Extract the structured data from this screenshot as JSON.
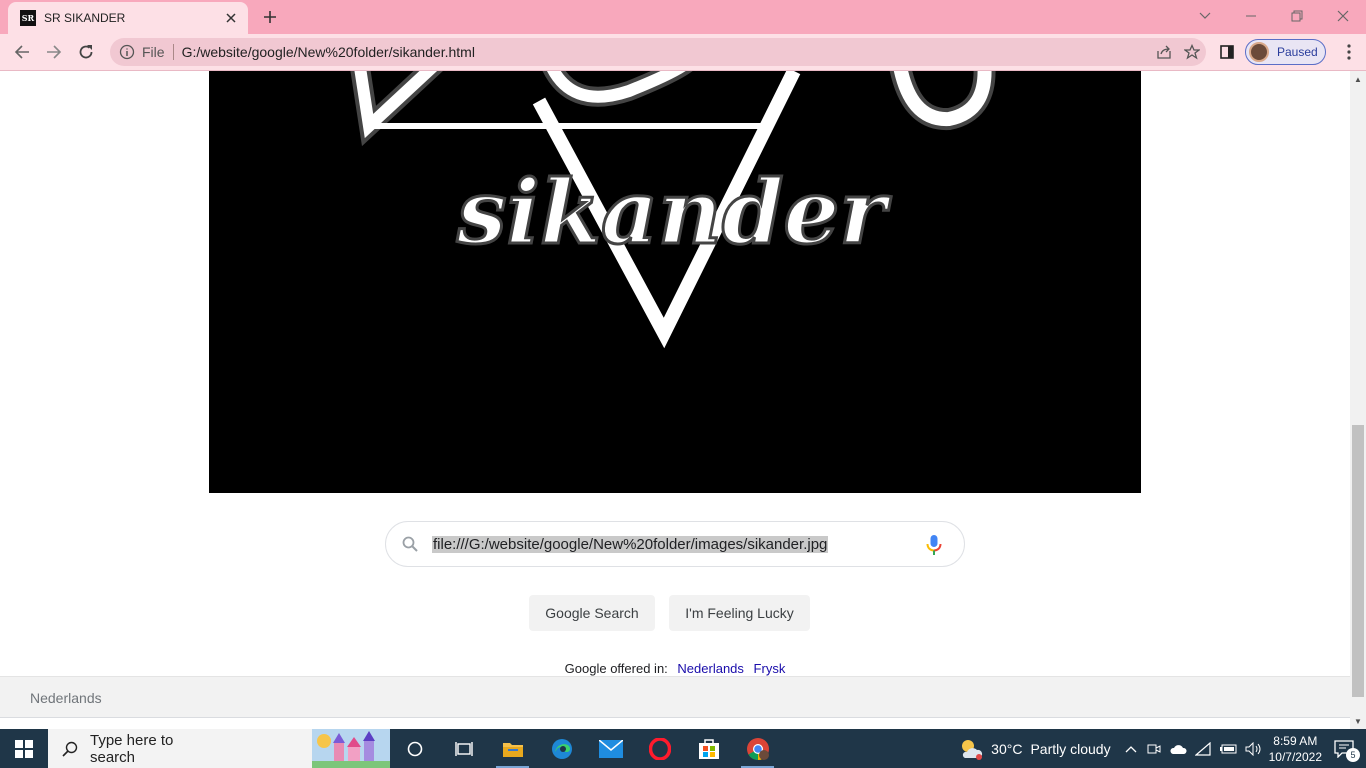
{
  "browser": {
    "tab": {
      "favicon_text": "SR",
      "title": "SR SIKANDER"
    },
    "address": {
      "scheme_label": "File",
      "url": "G:/website/google/New%20folder/sikander.html"
    },
    "profile": {
      "status": "Paused"
    }
  },
  "page": {
    "logo_text": "sikander",
    "search": {
      "value": "file:///G:/website/google/New%20folder/images/sikander.jpg"
    },
    "buttons": {
      "google_search": "Google Search",
      "feeling_lucky": "I'm Feeling Lucky"
    },
    "offered": {
      "label": "Google offered in:",
      "languages": [
        "Nederlands",
        "Frysk"
      ]
    },
    "footer": {
      "country": "Nederlands"
    }
  },
  "taskbar": {
    "search_placeholder": "Type here to search",
    "weather": {
      "temp": "30°C",
      "condition": "Partly cloudy"
    },
    "clock": {
      "time": "8:59 AM",
      "date": "10/7/2022"
    },
    "notifications": "5"
  }
}
